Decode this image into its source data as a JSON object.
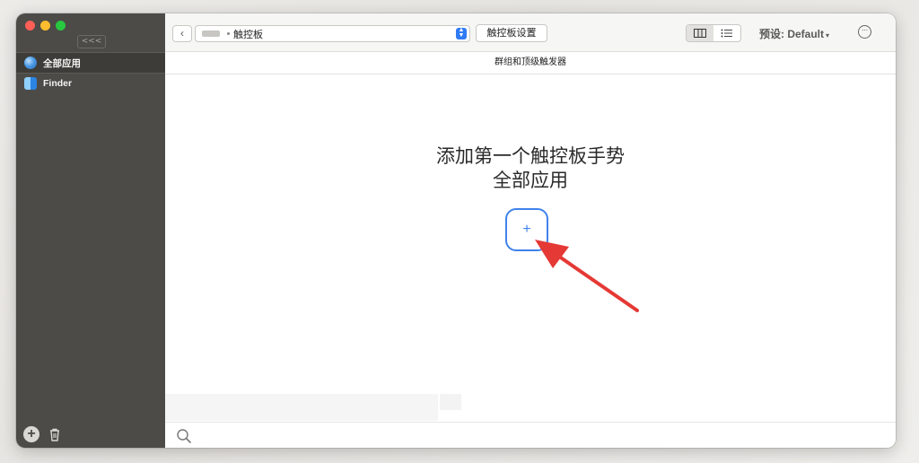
{
  "sidebar": {
    "collapse_label": "<<<",
    "items": [
      {
        "label": "全部应用",
        "icon": "globe-icon"
      },
      {
        "label": "Finder",
        "icon": "finder-icon"
      }
    ]
  },
  "toolbar": {
    "device_label": "触控板",
    "settings_label": "触控板设置",
    "preset_label": "预设: Default",
    "preset_caret": "▾"
  },
  "section": {
    "title": "群组和顶级触发器"
  },
  "empty_state": {
    "line1": "添加第一个触控板手势",
    "line2": "全部应用",
    "add_symbol": "+"
  },
  "colors": {
    "accent": "#3f82ec",
    "annotation_arrow": "#e53935",
    "sidebar_bg": "#4c4b47"
  }
}
